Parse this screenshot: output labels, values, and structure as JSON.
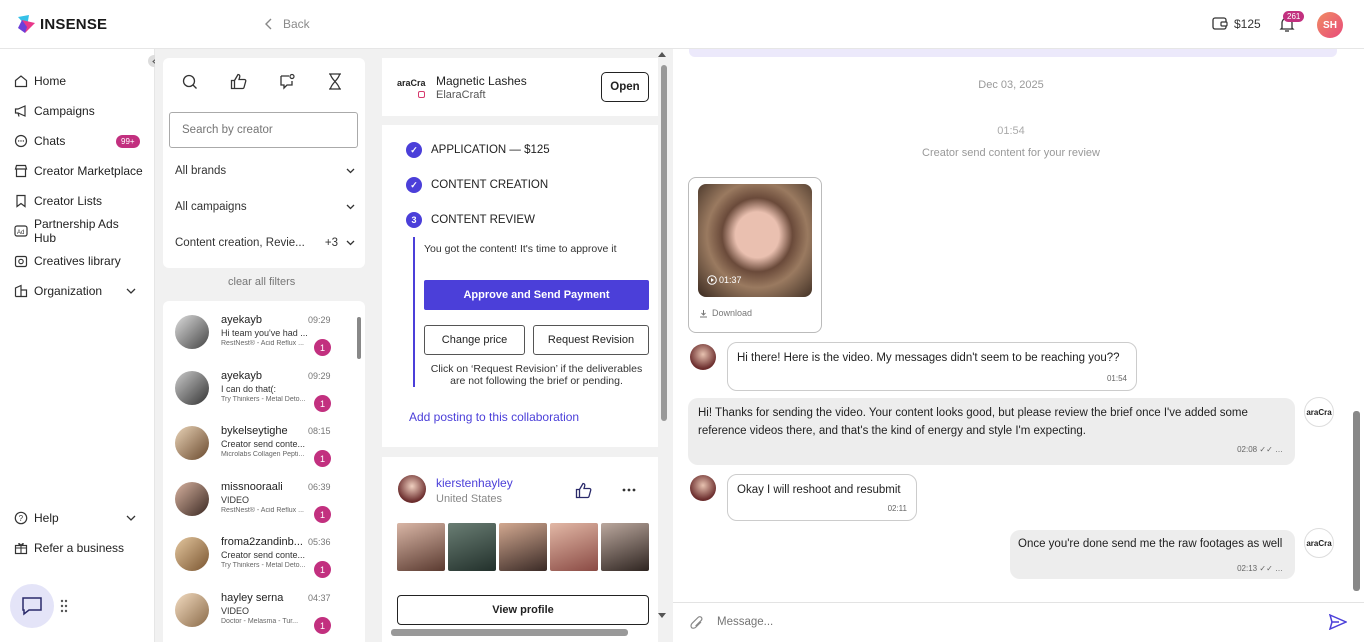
{
  "header": {
    "logo": "INSENSE",
    "back_label": "Back",
    "wallet_amount": "$125",
    "notifications_count": "261",
    "user_initials": "SH"
  },
  "sidebar": {
    "items": [
      {
        "label": "Home",
        "icon": "home-icon"
      },
      {
        "label": "Campaigns",
        "icon": "megaphone-icon"
      },
      {
        "label": "Chats",
        "icon": "chat-icon",
        "badge": "99+"
      },
      {
        "label": "Creator Marketplace",
        "icon": "store-icon"
      },
      {
        "label": "Creator Lists",
        "icon": "bookmark-icon"
      },
      {
        "label": "Partnership Ads Hub",
        "icon": "ad-icon"
      },
      {
        "label": "Creatives library",
        "icon": "gallery-icon"
      },
      {
        "label": "Organization",
        "icon": "organization-icon"
      }
    ],
    "help_label": "Help",
    "refer_label": "Refer a business"
  },
  "filters": {
    "search_placeholder": "Search by creator",
    "brands": "All brands",
    "campaigns": "All campaigns",
    "stages": "Content creation, Revie...",
    "stages_more": "+3",
    "clear": "clear all filters"
  },
  "chat_list": [
    {
      "name": "ayekayb",
      "time": "09:29",
      "msg": "Hi team you've had ...",
      "sub": "RestNest® - Acid Reflux ...",
      "count": "1"
    },
    {
      "name": "ayekayb",
      "time": "09:29",
      "msg": "I can do that(:",
      "sub": "Try Thinkers - Metal Deto...",
      "count": "1"
    },
    {
      "name": "bykelseytighe",
      "time": "08:15",
      "msg": "Creator send conte...",
      "sub": "Microlabs Collagen Pepti...",
      "count": "1"
    },
    {
      "name": "missnooraali",
      "time": "06:39",
      "msg": "VIDEO",
      "sub": "RestNest® - Acid Reflux ...",
      "count": "1"
    },
    {
      "name": "froma2zandinb...",
      "time": "05:36",
      "msg": "Creator send conte...",
      "sub": "Try Thinkers - Metal Deto...",
      "count": "1"
    },
    {
      "name": "hayley serna",
      "time": "04:37",
      "msg": "VIDEO",
      "sub": "Doctor - Melasma - Tur...",
      "count": "1"
    }
  ],
  "collab": {
    "brand_logo_text": "araCra",
    "campaign": "Magnetic Lashes",
    "brand": "ElaraCraft",
    "open_label": "Open",
    "steps": [
      {
        "label": "APPLICATION — $125",
        "mark": "✓"
      },
      {
        "label": "CONTENT CREATION",
        "mark": "✓"
      },
      {
        "label": "CONTENT REVIEW",
        "mark": "3"
      }
    ],
    "review_text": "You got the content! It's time to approve it",
    "approve_label": "Approve and Send Payment",
    "change_price_label": "Change price",
    "request_revision_label": "Request Revision",
    "revision_hint": "Click on ‘Request Revision’ if the deliverables are not following the brief or pending.",
    "add_posting_label": "Add posting to this collaboration"
  },
  "creator": {
    "name": "kierstenhayley",
    "country": "United States",
    "view_profile_label": "View profile"
  },
  "chat": {
    "date": "Dec 03, 2025",
    "sys_time": "01:54",
    "sys_text": "Creator send content for your review",
    "video_duration": "01:37",
    "download_label": "Download",
    "messages": [
      {
        "text": "Hi there! Here is the video. My messages didn't seem to be reaching you??",
        "time": "01:54"
      },
      {
        "text": "Hi! Thanks for sending the video. Your content looks good, but please review the brief once I've added some reference videos there, and that's the kind of energy and style I'm expecting.",
        "time": "02:08"
      },
      {
        "text": "Okay I will reshoot and resubmit",
        "time": "02:11"
      },
      {
        "text": "Once you're done send me the raw footages as well",
        "time": "02:13"
      }
    ],
    "brand_avatar_text": "araCra",
    "input_placeholder": "Message..."
  },
  "colors": {
    "accent": "#4b3fd9",
    "badge": "#c2307f",
    "link": "#4b3fd9"
  }
}
